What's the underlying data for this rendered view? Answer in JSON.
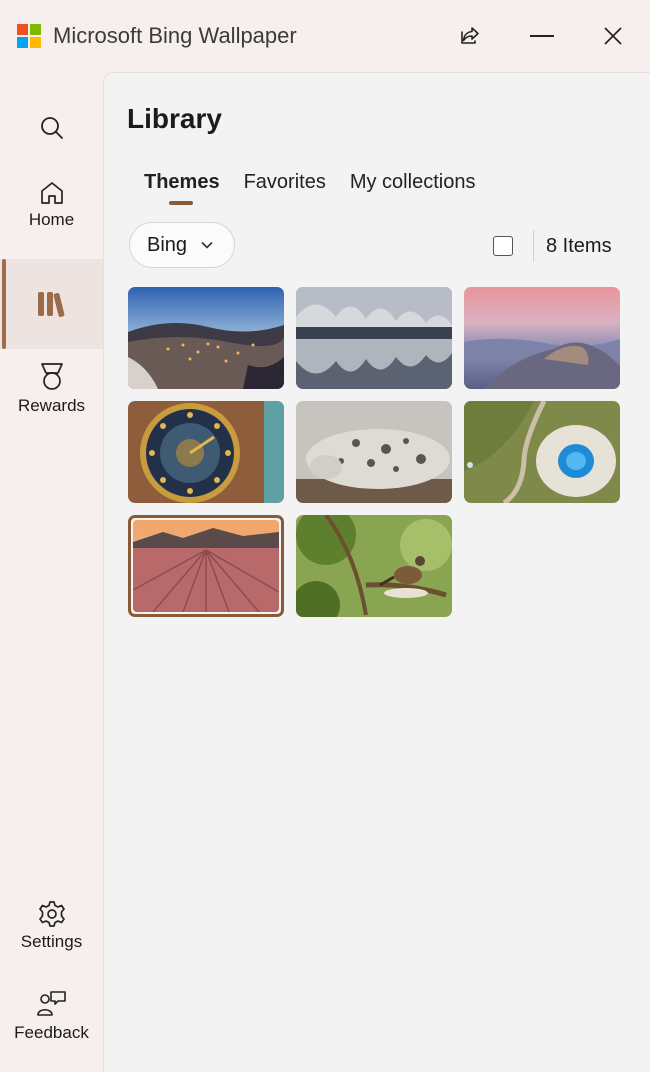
{
  "window": {
    "title": "Microsoft Bing Wallpaper"
  },
  "titlebar_icons": [
    "share-icon",
    "minimize-icon",
    "close-icon"
  ],
  "sidebar": {
    "items": [
      {
        "label": "",
        "icon": "search-icon"
      },
      {
        "label": "Home",
        "icon": "home-icon"
      },
      {
        "label": "",
        "icon": "library-icon",
        "selected": true
      },
      {
        "label": "Rewards",
        "icon": "medal-icon"
      },
      {
        "label": "Settings",
        "icon": "gear-icon"
      },
      {
        "label": "Feedback",
        "icon": "feedback-icon"
      }
    ]
  },
  "library": {
    "title": "Library",
    "tabs": [
      {
        "label": "Themes",
        "active": true
      },
      {
        "label": "Favorites",
        "active": false
      },
      {
        "label": "My collections",
        "active": false
      }
    ],
    "filter": {
      "selected": "Bing"
    },
    "item_count": "8 Items",
    "thumbnails": [
      {
        "subject": "hillside town at dusk"
      },
      {
        "subject": "wave-roof building reflected in water"
      },
      {
        "subject": "misty mountains at sunrise"
      },
      {
        "subject": "astronomical clock"
      },
      {
        "subject": "seal pup on rocks"
      },
      {
        "subject": "blue hot spring aerial"
      },
      {
        "subject": "lavender field at sunset",
        "selected": true
      },
      {
        "subject": "bird on branch in forest"
      }
    ]
  },
  "colors": {
    "accent": "#8a5a36",
    "sidebar_bg": "#f7efed",
    "content_bg": "#f3f3f3"
  }
}
